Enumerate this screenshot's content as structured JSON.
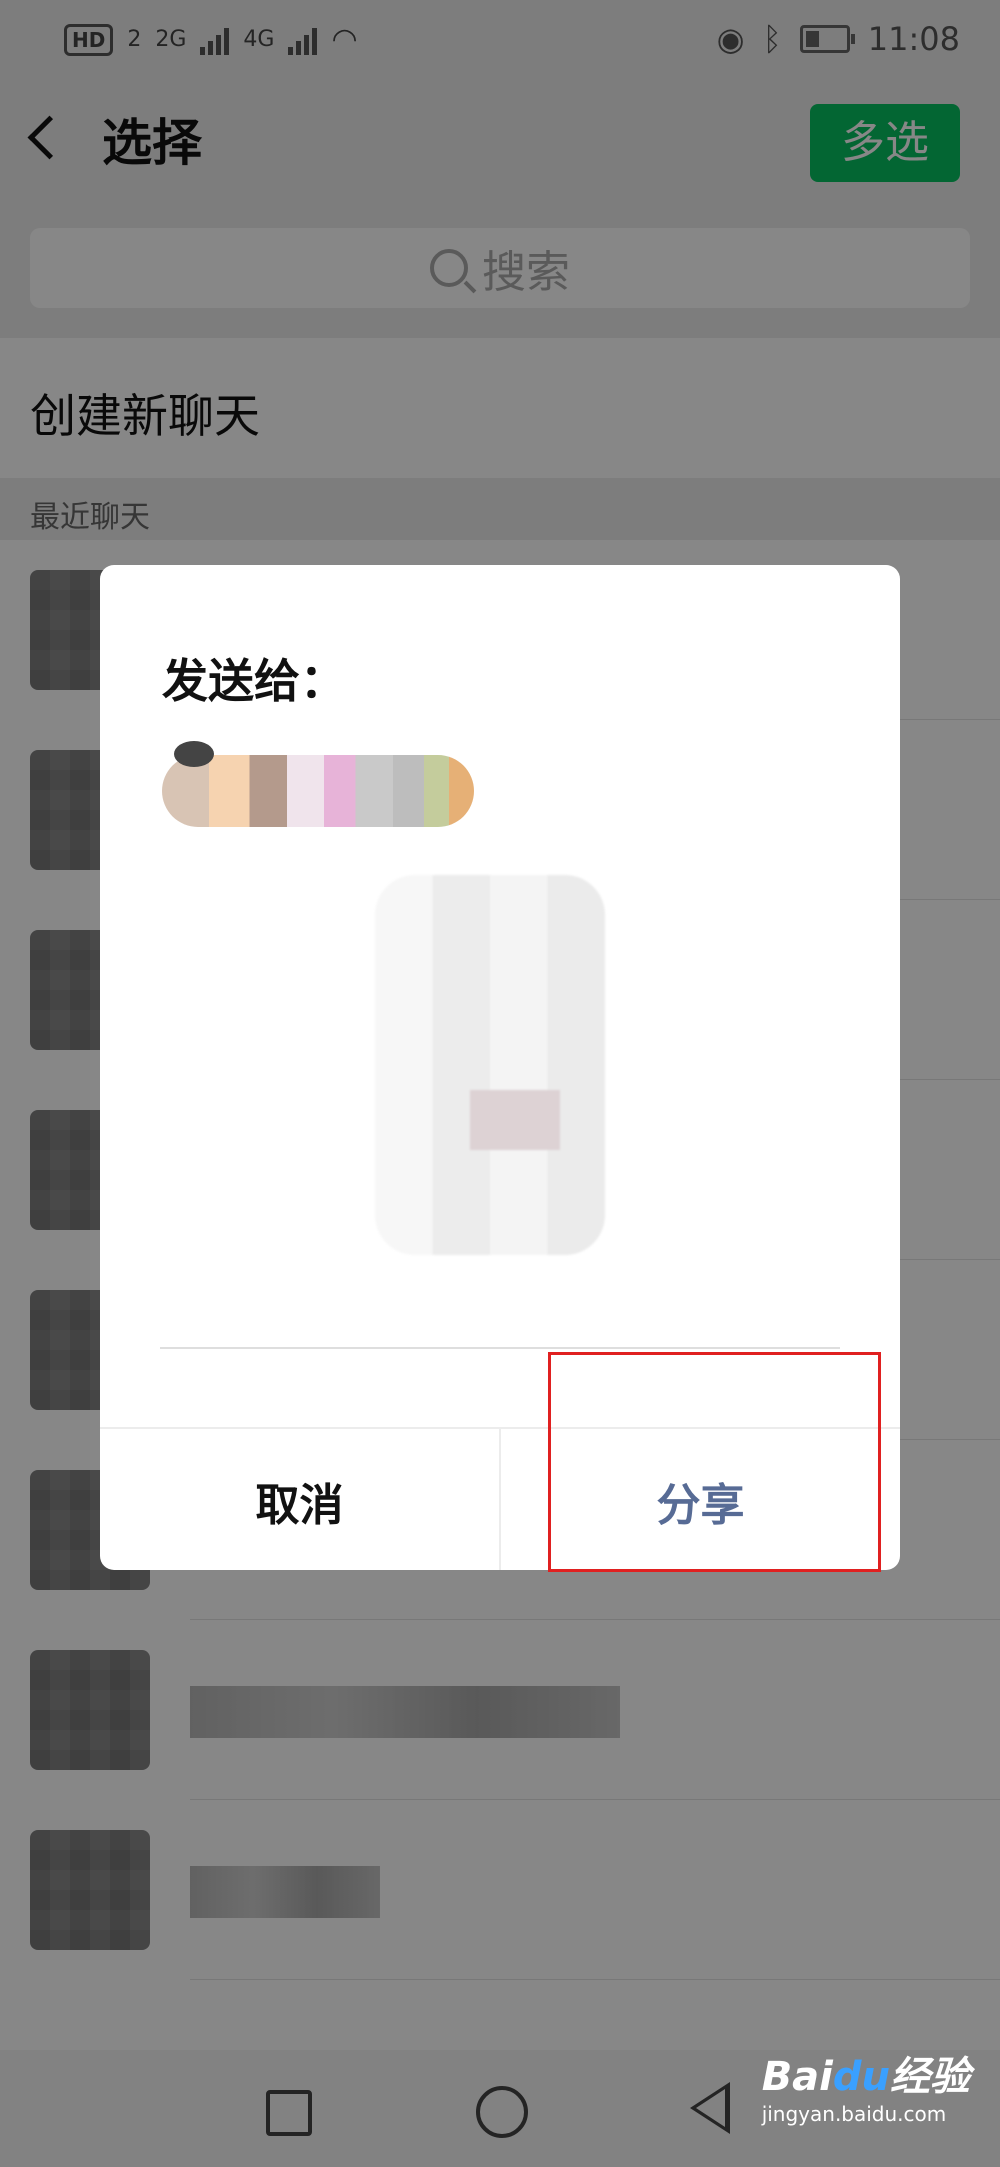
{
  "status_bar": {
    "hd": "HD",
    "sim_index": "2",
    "network_1": "2G",
    "network_2": "4G",
    "time": "11:08"
  },
  "header": {
    "title": "选择",
    "multi_select_label": "多选"
  },
  "search": {
    "placeholder": "搜索"
  },
  "new_chat_label": "创建新聊天",
  "recent_section_label": "最近聊天",
  "dialog": {
    "title": "发送给：",
    "cancel_label": "取消",
    "share_label": "分享"
  },
  "watermark": {
    "brand": "Bai",
    "brand_accent": "du",
    "brand_suffix": "经验",
    "url": "jingyan.baidu.com"
  },
  "colors": {
    "accent_green": "#07c160",
    "link_blue": "#576b95",
    "highlight_red": "#e02020"
  }
}
